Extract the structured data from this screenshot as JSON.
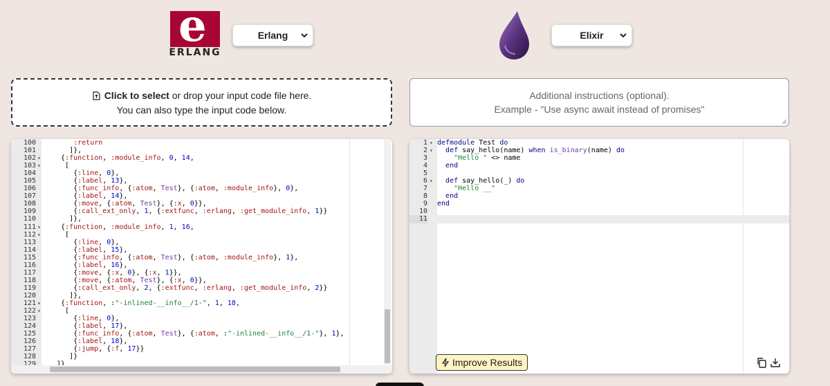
{
  "header": {
    "source_logo_letter": "e",
    "source_logo_word": "ERLANG",
    "source_language": "Erlang",
    "target_language": "Elixir",
    "icons": [
      "erlang-logo",
      "elixir-drop-logo",
      "chevron-down-icon"
    ]
  },
  "dropzone": {
    "link_text": "Click to select",
    "rest_text": " or drop your input code file here.",
    "line2": "You can also type the input code below."
  },
  "instructions": {
    "line1": "Additional instructions (optional).",
    "line2": "Example - \"Use async await instead of promises\""
  },
  "input_editor": {
    "lines": [
      {
        "n": "100",
        "fold": "",
        "text": "     :return"
      },
      {
        "n": "101",
        "fold": "",
        "text": "    ]},"
      },
      {
        "n": "102",
        "fold": "▾",
        "text": "  {:function, :module_info, 0, 14,"
      },
      {
        "n": "103",
        "fold": "▾",
        "text": "   ["
      },
      {
        "n": "104",
        "fold": "",
        "text": "     {:line, 0},"
      },
      {
        "n": "105",
        "fold": "",
        "text": "     {:label, 13},"
      },
      {
        "n": "106",
        "fold": "",
        "text": "     {:func_info, {:atom, Test}, {:atom, :module_info}, 0},"
      },
      {
        "n": "107",
        "fold": "",
        "text": "     {:label, 14},"
      },
      {
        "n": "108",
        "fold": "",
        "text": "     {:move, {:atom, Test}, {:x, 0}},"
      },
      {
        "n": "109",
        "fold": "",
        "text": "     {:call_ext_only, 1, {:extfunc, :erlang, :get_module_info, 1}}"
      },
      {
        "n": "110",
        "fold": "",
        "text": "    ]},"
      },
      {
        "n": "111",
        "fold": "▾",
        "text": "  {:function, :module_info, 1, 16,"
      },
      {
        "n": "112",
        "fold": "▾",
        "text": "   ["
      },
      {
        "n": "113",
        "fold": "",
        "text": "     {:line, 0},"
      },
      {
        "n": "114",
        "fold": "",
        "text": "     {:label, 15},"
      },
      {
        "n": "115",
        "fold": "",
        "text": "     {:func_info, {:atom, Test}, {:atom, :module_info}, 1},"
      },
      {
        "n": "116",
        "fold": "",
        "text": "     {:label, 16},"
      },
      {
        "n": "117",
        "fold": "",
        "text": "     {:move, {:x, 0}, {:x, 1}},"
      },
      {
        "n": "118",
        "fold": "",
        "text": "     {:move, {:atom, Test}, {:x, 0}},"
      },
      {
        "n": "119",
        "fold": "",
        "text": "     {:call_ext_only, 2, {:extfunc, :erlang, :get_module_info, 2}}"
      },
      {
        "n": "120",
        "fold": "",
        "text": "    ]},"
      },
      {
        "n": "121",
        "fold": "▾",
        "text": "  {:function, :\"-inlined-__info__/1-\", 1, 18,"
      },
      {
        "n": "122",
        "fold": "▾",
        "text": "   ["
      },
      {
        "n": "123",
        "fold": "",
        "text": "     {:line, 0},"
      },
      {
        "n": "124",
        "fold": "",
        "text": "     {:label, 17},"
      },
      {
        "n": "125",
        "fold": "",
        "text": "     {:func_info, {:atom, Test}, {:atom, :\"-inlined-__info__/1-\"}, 1},"
      },
      {
        "n": "126",
        "fold": "",
        "text": "     {:label, 18},"
      },
      {
        "n": "127",
        "fold": "",
        "text": "     {:jump, {:f, 17}}"
      },
      {
        "n": "128",
        "fold": "",
        "text": "    ]}"
      },
      {
        "n": "129",
        "fold": "",
        "text": " ]}"
      }
    ]
  },
  "output_editor": {
    "lines": [
      {
        "n": "1",
        "fold": "▾",
        "text": "defmodule Test do"
      },
      {
        "n": "2",
        "fold": "▾",
        "text": "  def say_hello(name) when is_binary(name) do"
      },
      {
        "n": "3",
        "fold": "",
        "text": "    \"Hello \" <> name"
      },
      {
        "n": "4",
        "fold": "",
        "text": "  end"
      },
      {
        "n": "5",
        "fold": "",
        "text": ""
      },
      {
        "n": "6",
        "fold": "▾",
        "text": "  def say_hello(_) do"
      },
      {
        "n": "7",
        "fold": "",
        "text": "    \"Hello __\""
      },
      {
        "n": "8",
        "fold": "",
        "text": "  end"
      },
      {
        "n": "9",
        "fold": "",
        "text": "end"
      },
      {
        "n": "10",
        "fold": "",
        "text": ""
      },
      {
        "n": "11",
        "fold": "",
        "text": ""
      }
    ],
    "improve_label": "Improve Results",
    "icons": [
      "bolt-icon",
      "copy-icon",
      "download-icon"
    ]
  }
}
